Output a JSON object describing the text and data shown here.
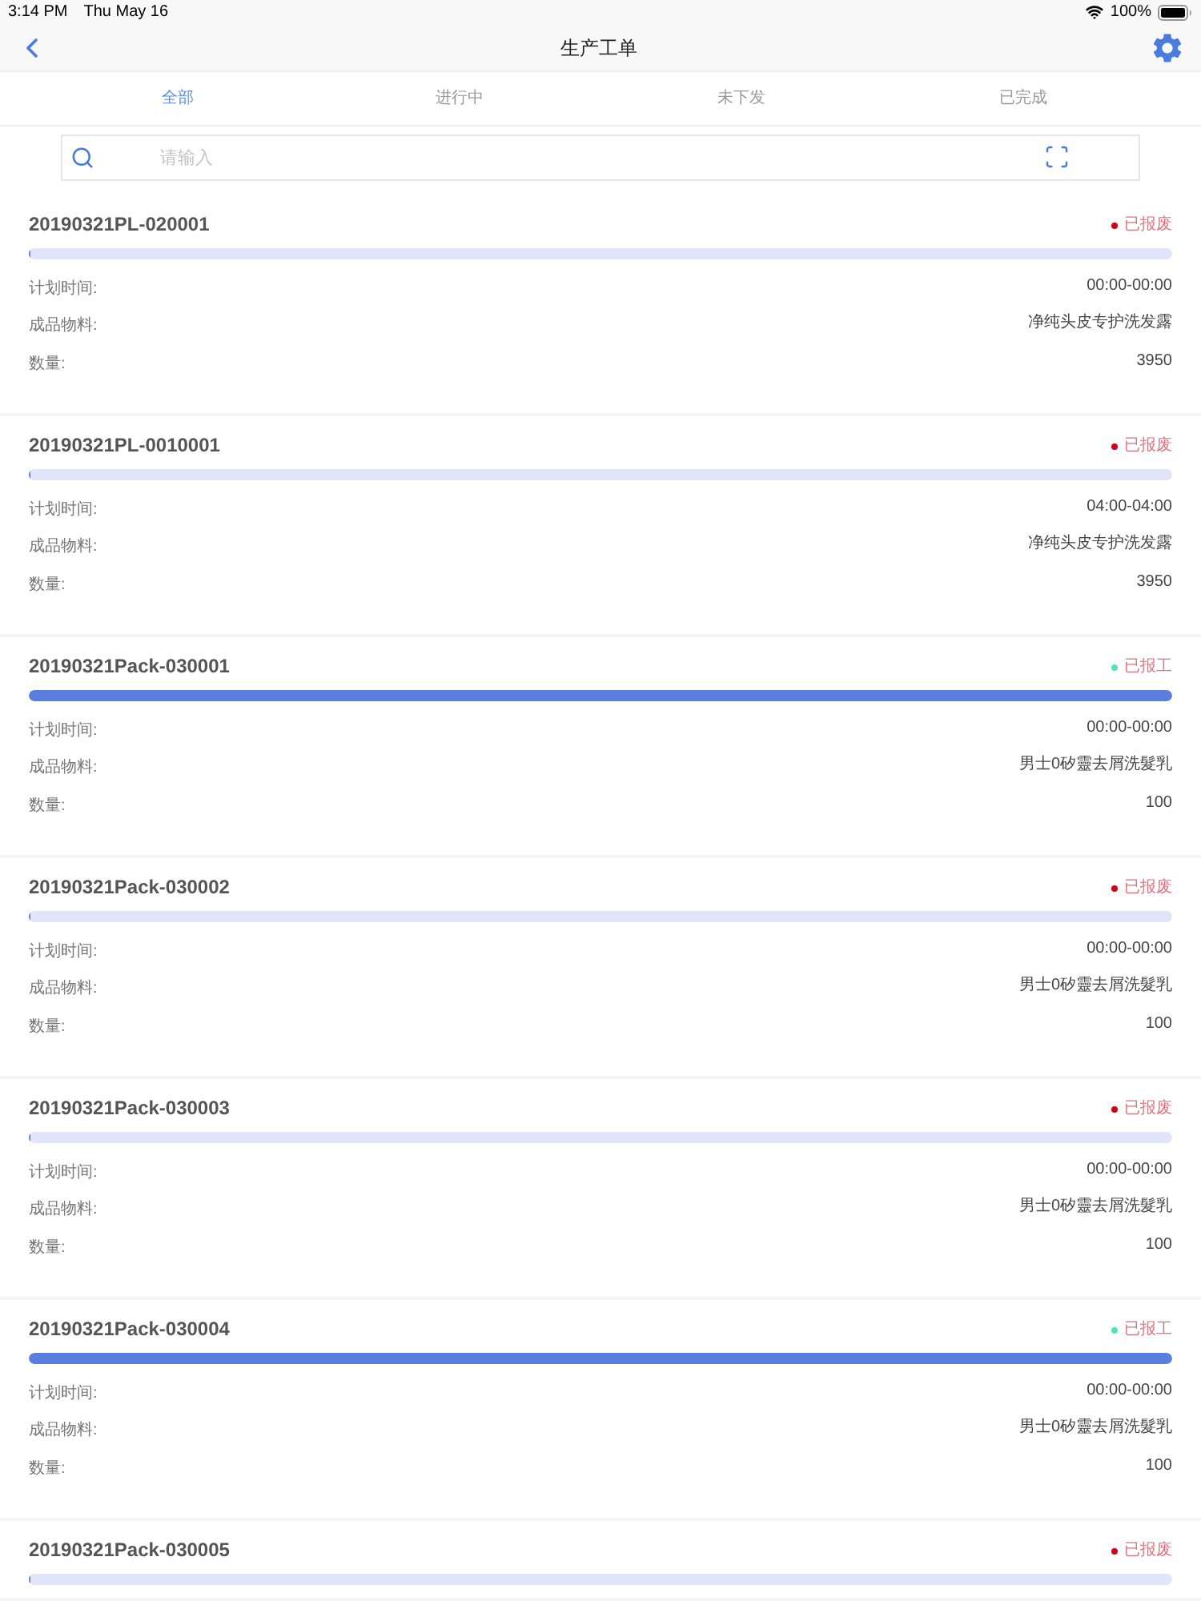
{
  "status_bar": {
    "time": "3:14 PM",
    "date": "Thu May 16",
    "battery": "100%"
  },
  "nav": {
    "title": "生产工单"
  },
  "tabs": [
    {
      "label": "全部",
      "selected": true
    },
    {
      "label": "进行中",
      "selected": false
    },
    {
      "label": "未下发",
      "selected": false
    },
    {
      "label": "已完成",
      "selected": false
    }
  ],
  "search": {
    "placeholder": "请输入"
  },
  "orders": [
    {
      "id": "20190321PL-020001",
      "status": {
        "label": "已报废",
        "color": "#d0021b"
      },
      "level": 0,
      "fields": [
        {
          "label": "计划时间:",
          "value": "00:00-00:00"
        },
        {
          "label": "成品物料:",
          "value": "净纯头皮专护洗发露"
        },
        {
          "label": "数量:",
          "value": "3950"
        }
      ]
    },
    {
      "id": "20190321PL-0010001",
      "status": {
        "label": "已报废",
        "color": "#d0021b"
      },
      "level": 0,
      "fields": [
        {
          "label": "计划时间:",
          "value": "04:00-04:00"
        },
        {
          "label": "成品物料:",
          "value": "净纯头皮专护洗发露"
        },
        {
          "label": "数量:",
          "value": "3950"
        }
      ]
    },
    {
      "id": "20190321Pack-030001",
      "status": {
        "label": "已报工",
        "color": "#50e3c2"
      },
      "level": 1,
      "fields": [
        {
          "label": "计划时间:",
          "value": "00:00-00:00"
        },
        {
          "label": "成品物料:",
          "value": "男士0矽靈去屑洗髮乳"
        },
        {
          "label": "数量:",
          "value": "100"
        }
      ]
    },
    {
      "id": "20190321Pack-030002",
      "status": {
        "label": "已报废",
        "color": "#d0021b"
      },
      "level": 0,
      "fields": [
        {
          "label": "计划时间:",
          "value": "00:00-00:00"
        },
        {
          "label": "成品物料:",
          "value": "男士0矽靈去屑洗髮乳"
        },
        {
          "label": "数量:",
          "value": "100"
        }
      ]
    },
    {
      "id": "20190321Pack-030003",
      "status": {
        "label": "已报废",
        "color": "#d0021b"
      },
      "level": 0,
      "fields": [
        {
          "label": "计划时间:",
          "value": "00:00-00:00"
        },
        {
          "label": "成品物料:",
          "value": "男士0矽靈去屑洗髮乳"
        },
        {
          "label": "数量:",
          "value": "100"
        }
      ]
    },
    {
      "id": "20190321Pack-030004",
      "status": {
        "label": "已报工",
        "color": "#50e3c2"
      },
      "level": 1,
      "fields": [
        {
          "label": "计划时间:",
          "value": "00:00-00:00"
        },
        {
          "label": "成品物料:",
          "value": "男士0矽靈去屑洗髮乳"
        },
        {
          "label": "数量:",
          "value": "100"
        }
      ]
    },
    {
      "id": "20190321Pack-030005",
      "status": {
        "label": "已报废",
        "color": "#d0021b"
      },
      "level": 0
    }
  ]
}
